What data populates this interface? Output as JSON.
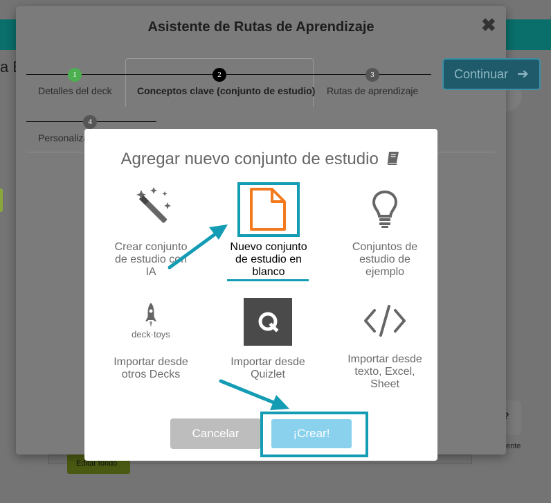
{
  "background": {
    "left_text": "a E",
    "edit_background_label": "Editar fondo",
    "right_fragment": "ente",
    "help_icon": "question-icon"
  },
  "wizard": {
    "title": "Asistente de Rutas de Aprendizaje",
    "close_icon": "close-icon",
    "continue_label": "Continuar",
    "steps": [
      {
        "number": "1",
        "label": "Detalles del deck",
        "color": "#4caf50"
      },
      {
        "number": "2",
        "label": "Conceptos clave (conjunto de estudio)",
        "color": "#000000"
      },
      {
        "number": "3",
        "label": "Rutas de aprendizaje",
        "color": "#555555"
      },
      {
        "number": "4",
        "label": "Personaliza",
        "color": "#555555"
      }
    ]
  },
  "modal": {
    "title": "Agregar nuevo conjunto de estudio",
    "title_icon": "book-icon",
    "options": [
      {
        "icon": "magic-wand-icon",
        "label_lines": [
          "Crear conjunto",
          "de estudio con",
          "IA"
        ]
      },
      {
        "icon": "blank-document-icon",
        "label_lines": [
          "Nuevo conjunto",
          "de estudio en",
          "blanco"
        ],
        "selected": true
      },
      {
        "icon": "lightbulb-icon",
        "label_lines": [
          "Conjuntos de",
          "estudio de",
          "ejemplo"
        ]
      },
      {
        "icon": "decktoys-logo",
        "logo_text": "deck·toys",
        "label_lines": [
          "Importar desde",
          "otros Decks"
        ]
      },
      {
        "icon": "quizlet-logo",
        "logo_text": "Q",
        "label_lines": [
          "Importar desde",
          "Quizlet"
        ]
      },
      {
        "icon": "code-icon",
        "label_lines": [
          "Importar desde",
          "texto, Excel,",
          "Sheet"
        ]
      }
    ],
    "cancel_label": "Cancelar",
    "create_label": "¡Crear!"
  },
  "colors": {
    "accent": "#139cb4",
    "document_orange": "#f47a1f",
    "create_button": "#8ad1ee",
    "cancel_button": "#bdbdbd"
  }
}
